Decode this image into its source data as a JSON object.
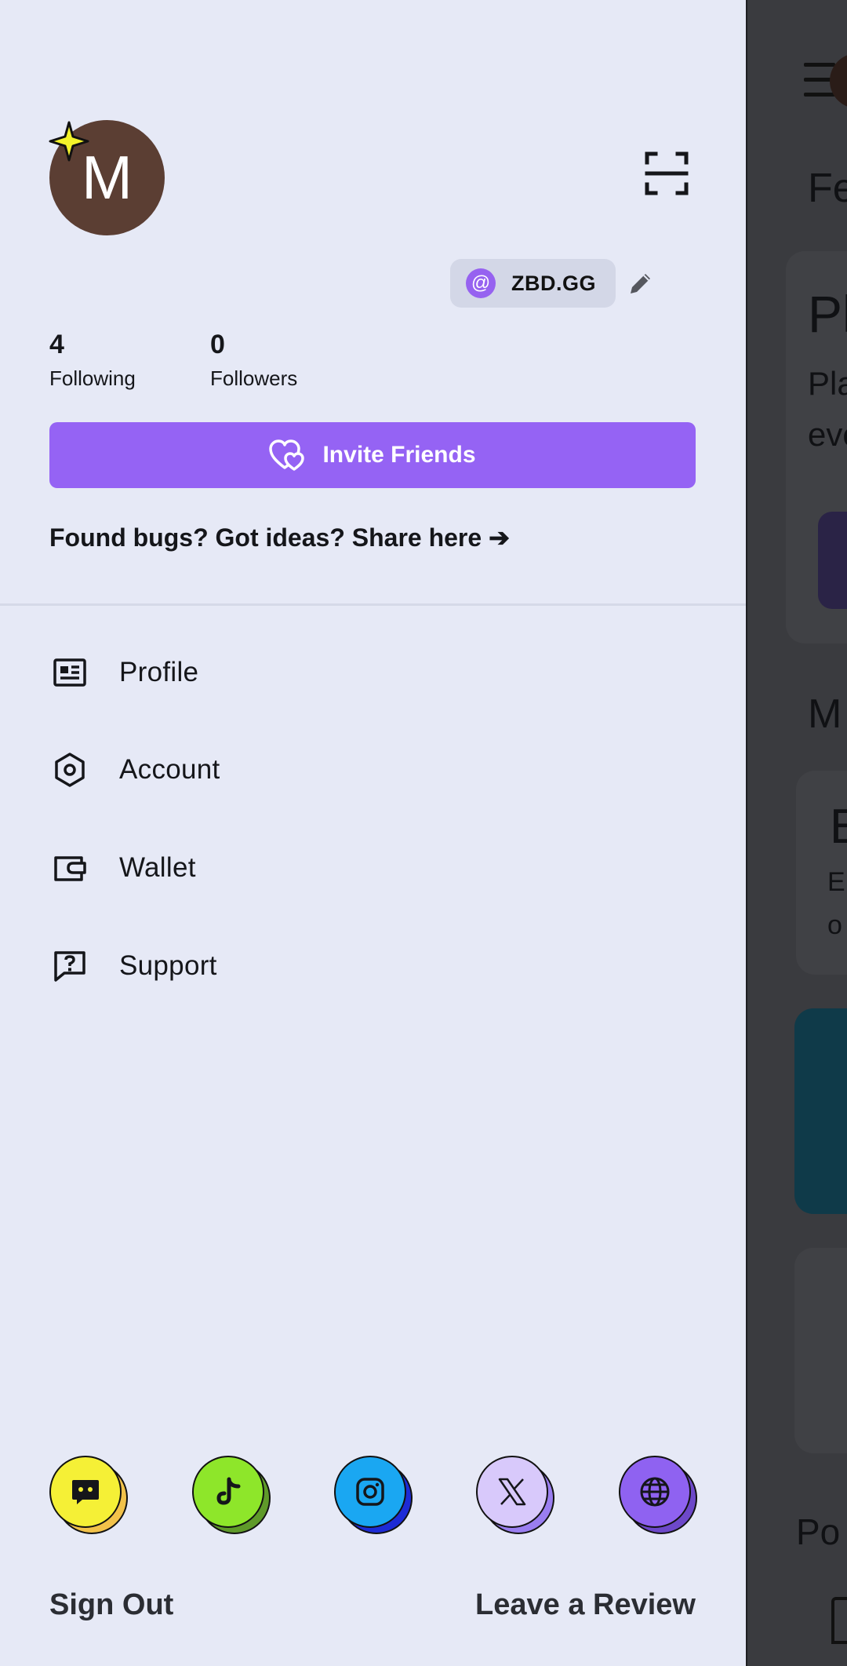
{
  "background_app": {
    "header_fragment": "Fe",
    "card1": {
      "title_fragment": "Pl",
      "line1_fragment": "Pla",
      "line2_fragment": "eve"
    },
    "section2_fragment": "M",
    "card2": {
      "title_fragment": "E",
      "line1_fragment": "E",
      "line2_fragment": "o"
    },
    "section3_fragment": "Po"
  },
  "profile": {
    "avatar_initial": "M",
    "username": "ZBD.GG",
    "at_symbol": "@",
    "following_count": "4",
    "following_label": "Following",
    "followers_count": "0",
    "followers_label": "Followers"
  },
  "invite_button_label": "Invite Friends",
  "feedback_link": "Found bugs? Got ideas? Share here ➔",
  "menu": [
    {
      "label": "Profile",
      "icon": "profile-card-icon"
    },
    {
      "label": "Account",
      "icon": "hexagon-icon"
    },
    {
      "label": "Wallet",
      "icon": "wallet-icon"
    },
    {
      "label": "Support",
      "icon": "help-chat-icon"
    }
  ],
  "socials": [
    {
      "name": "discord",
      "icon": "discord-icon",
      "color": "#f5f036",
      "shadow": "#f2c24a"
    },
    {
      "name": "tiktok",
      "icon": "tiktok-icon",
      "color": "#8ee62a",
      "shadow": "#5f9a2a"
    },
    {
      "name": "instagram",
      "icon": "instagram-icon",
      "color": "#1aa7f2",
      "shadow": "#1d2bd6"
    },
    {
      "name": "x",
      "icon": "x-logo-icon",
      "color": "#d8c9fb",
      "shadow": "#9a7ef0"
    },
    {
      "name": "website",
      "icon": "globe-icon",
      "color": "#8f62f1",
      "shadow": "#6d48c9"
    }
  ],
  "footer": {
    "sign_out": "Sign Out",
    "leave_review": "Leave a Review"
  },
  "colors": {
    "drawer_bg": "#e6e9f6",
    "accent_purple": "#9563f4",
    "avatar_bg": "#5b3e33",
    "star_yellow": "#f3f32a"
  }
}
